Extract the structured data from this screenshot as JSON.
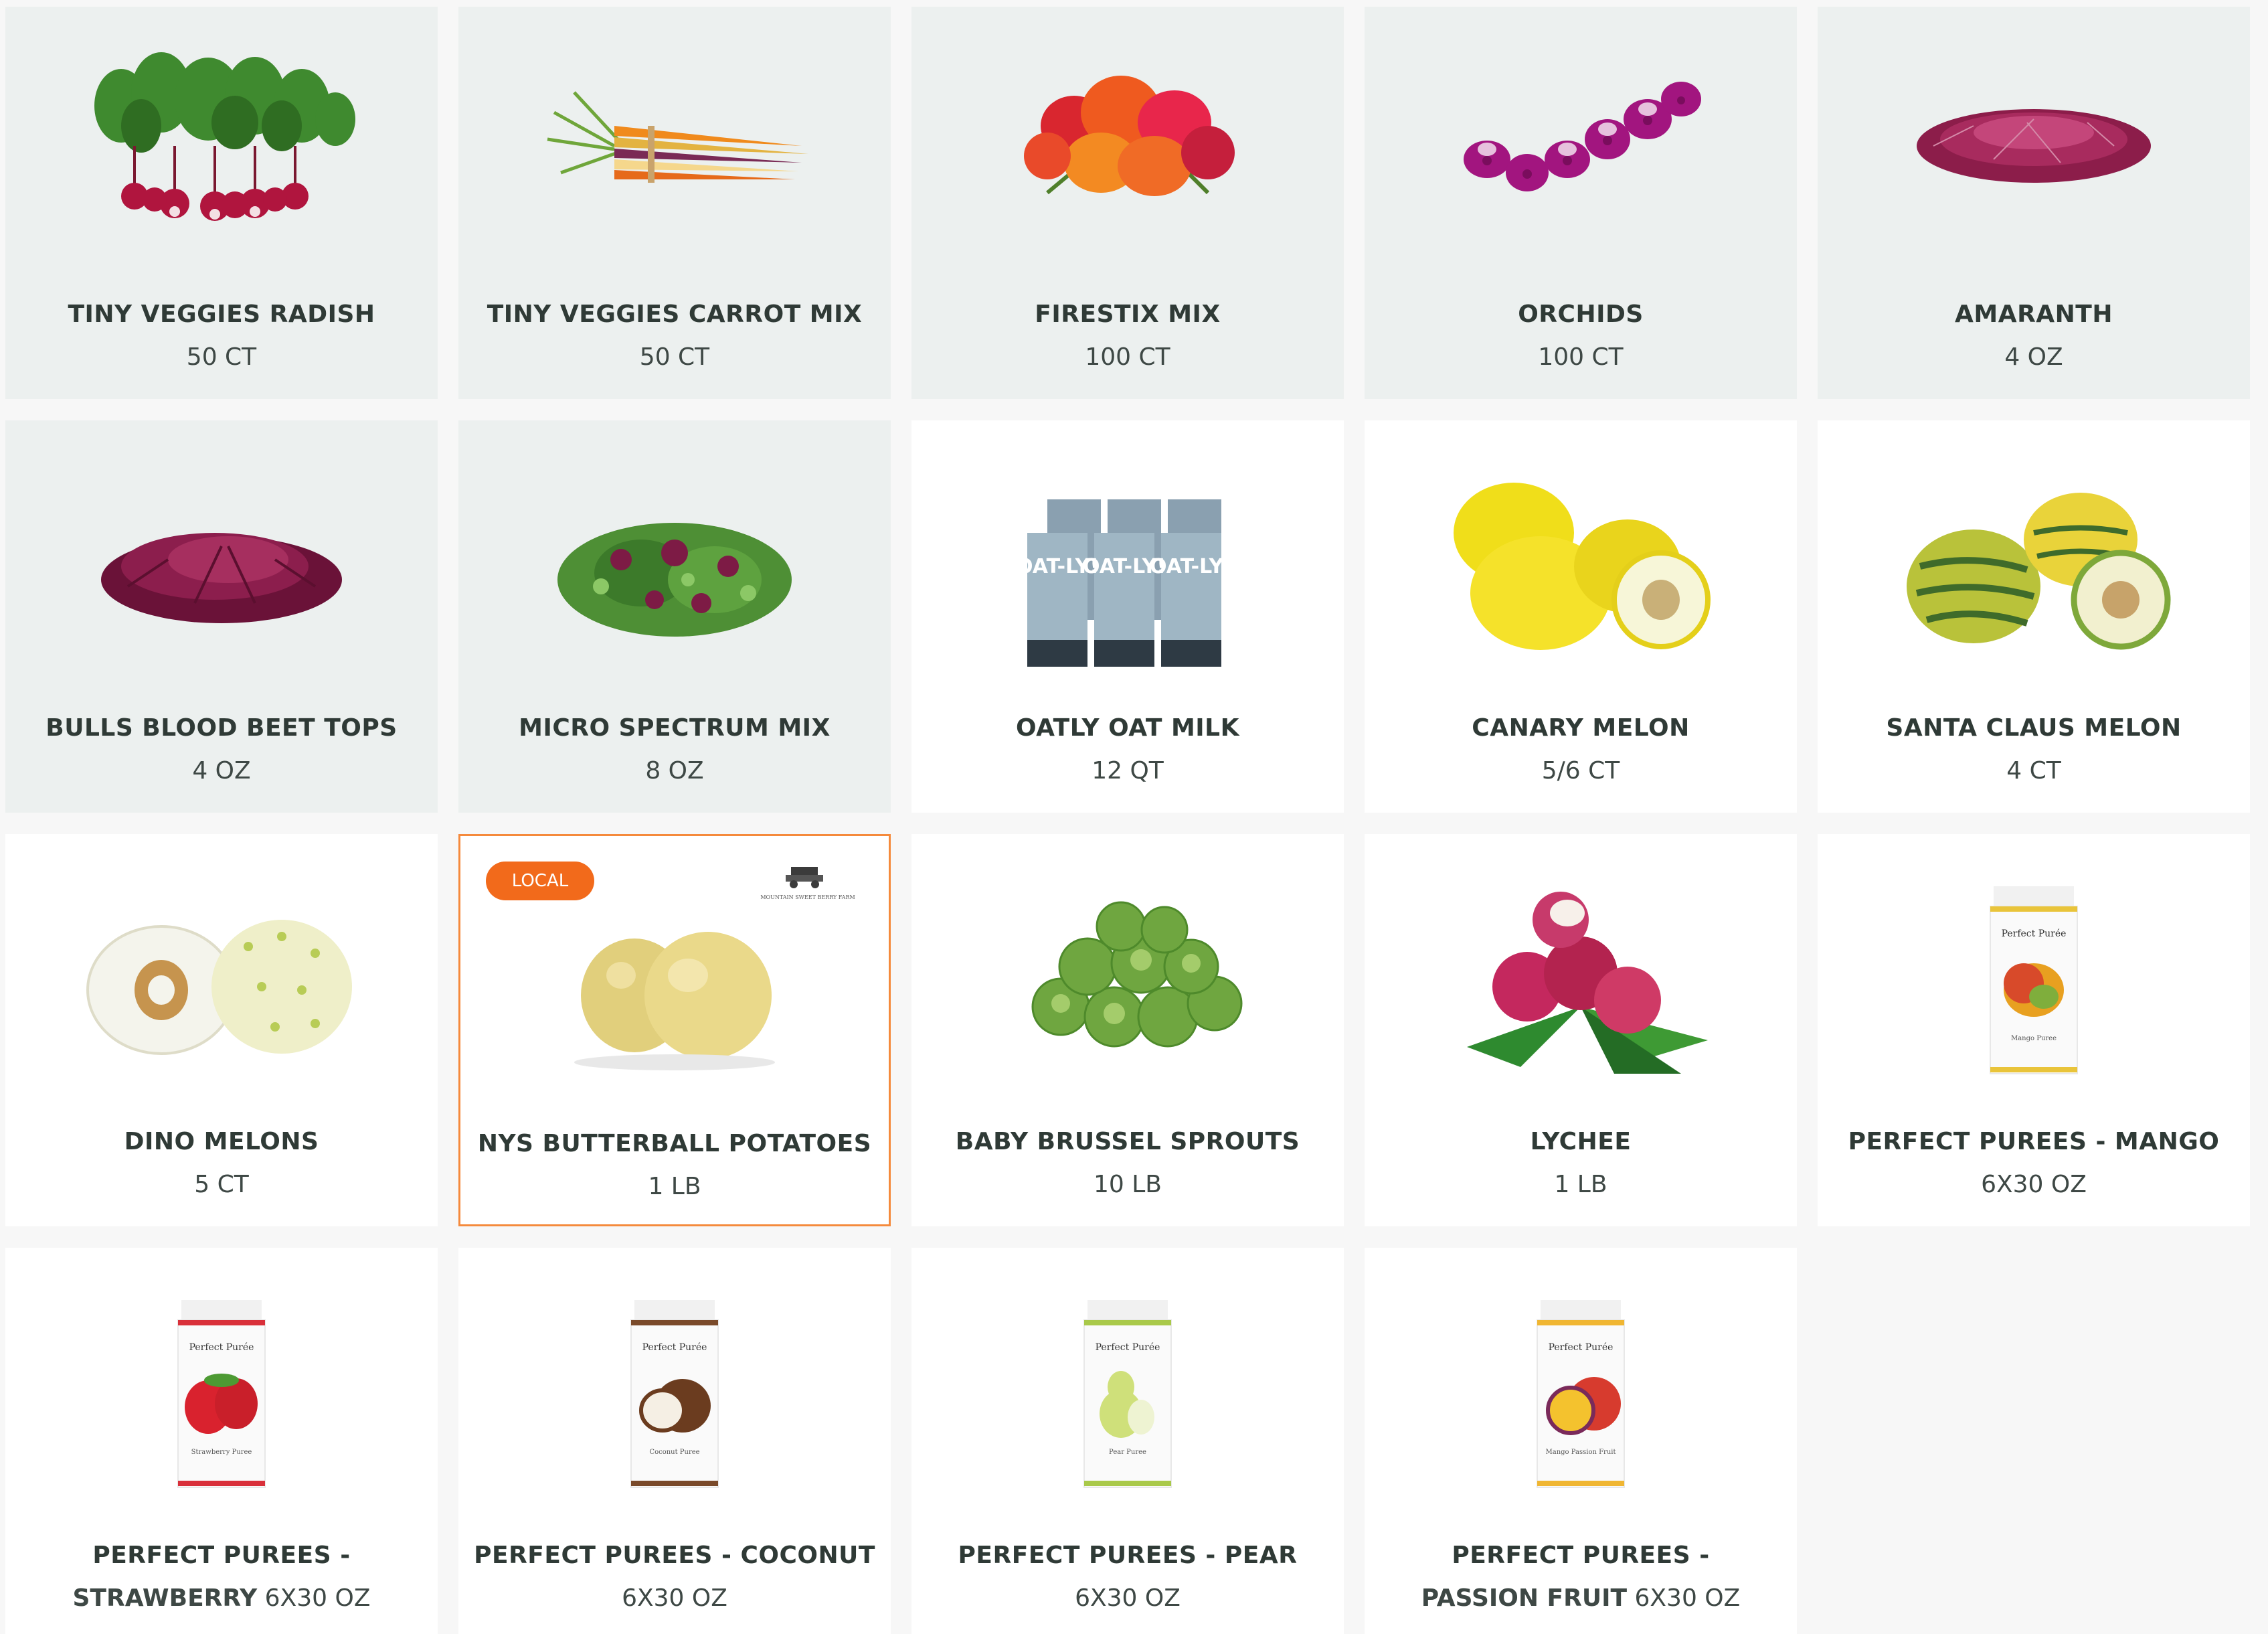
{
  "products": [
    {
      "name": "TINY VEGGIES RADISH",
      "size": "50 CT",
      "icon": "radish-image",
      "tinted": true
    },
    {
      "name": "TINY VEGGIES CARROT MIX",
      "size": "50 CT",
      "icon": "carrot-image",
      "tinted": true
    },
    {
      "name": "FIRESTIX MIX",
      "size": "100 CT",
      "icon": "firestix-image",
      "tinted": true
    },
    {
      "name": "ORCHIDS",
      "size": "100 CT",
      "icon": "orchid-image",
      "tinted": true
    },
    {
      "name": "AMARANTH",
      "size": "4 OZ",
      "icon": "amaranth-image",
      "tinted": true
    },
    {
      "name": "BULLS BLOOD BEET TOPS",
      "size": "4 OZ",
      "icon": "beet-tops-image",
      "tinted": true
    },
    {
      "name": "MICRO SPECTRUM MIX",
      "size": "8 OZ",
      "icon": "micro-mix-image",
      "tinted": true
    },
    {
      "name": "OATLY OAT MILK",
      "size": "12 QT",
      "icon": "oat-milk-image",
      "tinted": false,
      "carton_text": "OAT-LY!"
    },
    {
      "name": "CANARY MELON",
      "size": "5/6 CT",
      "icon": "canary-melon-image",
      "tinted": false
    },
    {
      "name": "SANTA CLAUS MELON",
      "size": "4 CT",
      "icon": "santa-claus-melon-image",
      "tinted": false
    },
    {
      "name": "DINO MELONS",
      "size": "5 CT",
      "icon": "dino-melon-image",
      "tinted": false
    },
    {
      "name": "NYS BUTTERBALL POTATOES",
      "size": "1 LB",
      "icon": "potato-image",
      "tinted": false,
      "badge": "LOCAL",
      "farm": "MOUNTAIN SWEET BERRY FARM"
    },
    {
      "name": "BABY BRUSSEL SPROUTS",
      "size": "10 LB",
      "icon": "brussel-sprouts-image",
      "tinted": false
    },
    {
      "name": "LYCHEE",
      "size": "1 LB",
      "icon": "lychee-image",
      "tinted": false
    },
    {
      "name": "PERFECT PUREES - MANGO",
      "size": "6X30 OZ",
      "icon": "mango-puree-image",
      "tinted": false,
      "jar_brand": "Perfect Purée",
      "jar_flavor": "Mango Puree"
    },
    {
      "name_line1": "PERFECT PUREES -",
      "name_line2": "STRAWBERRY",
      "size": "6X30 OZ",
      "icon": "strawberry-puree-image",
      "tinted": false,
      "jar_brand": "Perfect Purée",
      "jar_flavor": "Strawberry Puree"
    },
    {
      "name": "PERFECT PUREES - COCONUT",
      "size": "6X30 OZ",
      "icon": "coconut-puree-image",
      "tinted": false,
      "jar_brand": "Perfect Purée",
      "jar_flavor": "Coconut Puree"
    },
    {
      "name": "PERFECT PUREES - PEAR",
      "size": "6X30 OZ",
      "icon": "pear-puree-image",
      "tinted": false,
      "jar_brand": "Perfect Purée",
      "jar_flavor": "Pear Puree"
    },
    {
      "name_line1": "PERFECT PUREES -",
      "name_line2": "PASSION FRUIT",
      "size": "6X30 OZ",
      "icon": "passion-fruit-puree-image",
      "tinted": false,
      "jar_brand": "Perfect Purée",
      "jar_flavor": "Mango Passion Fruit"
    }
  ],
  "colors": {
    "tint": "#ecf0ef",
    "card": "#ffffff",
    "page": "#f7f7f7",
    "text": "#2f3a36",
    "badge": "#f26a1b",
    "highlight_border": "#f58a3c"
  }
}
